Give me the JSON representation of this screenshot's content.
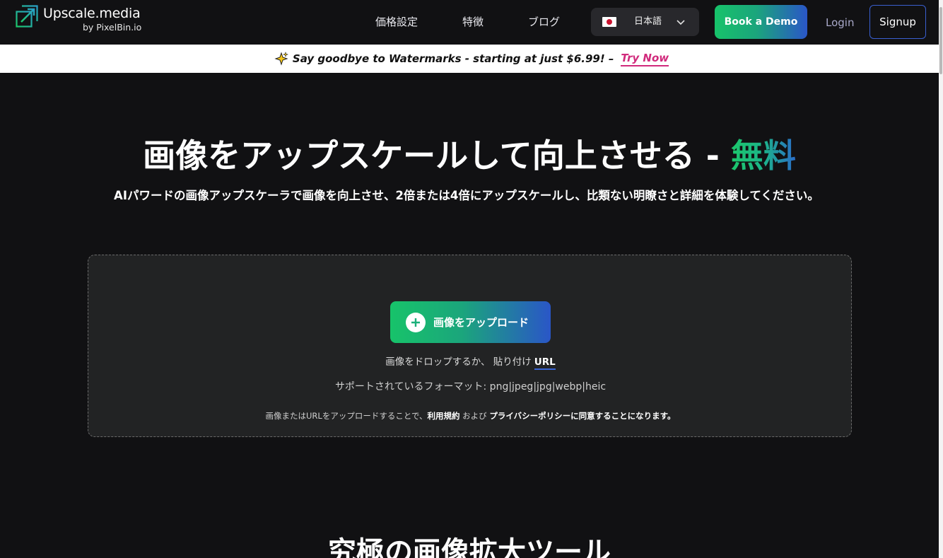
{
  "header": {
    "logo_name": "Upscale.media",
    "logo_by": "by PixelBin.io",
    "nav": [
      {
        "label": "価格設定"
      },
      {
        "label": "特徴"
      },
      {
        "label": "ブログ"
      }
    ],
    "language": {
      "label": "日本語",
      "flag_icon": "japan-flag-icon"
    },
    "book_demo": "Book a Demo",
    "login": "Login",
    "signup": "Signup"
  },
  "promo": {
    "icon": "sparkle-icon",
    "text": "Say goodbye to Watermarks - starting at just $6.99! –",
    "cta": "Try Now"
  },
  "hero": {
    "title": "画像をアップスケールして向上させる - ",
    "title_accent": "無料",
    "subtitle": "AIパワードの画像アップスケーラで画像を向上させ、2倍または4倍にアップスケールし、比類ない明瞭さと詳細を体験してください。"
  },
  "upload": {
    "button_label": "画像をアップロード",
    "drop_text": "画像をドロップするか、 貼り付け",
    "url_link": "URL",
    "formats_text": "サポートされているフォーマット: png|jpeg|jpg|webp|heic",
    "terms_prefix": "画像またはURLをアップロードすることで、",
    "terms_link": "利用規約",
    "terms_and": " および ",
    "privacy_link": "プライバシーポリシーに同意することになります。"
  },
  "section2": {
    "title": "究極の画像拡大ツール"
  },
  "colors": {
    "background": "#111113",
    "accent_green": "#17c36a",
    "accent_blue": "#2a56c7",
    "promo_cta": "#d12a7c"
  }
}
